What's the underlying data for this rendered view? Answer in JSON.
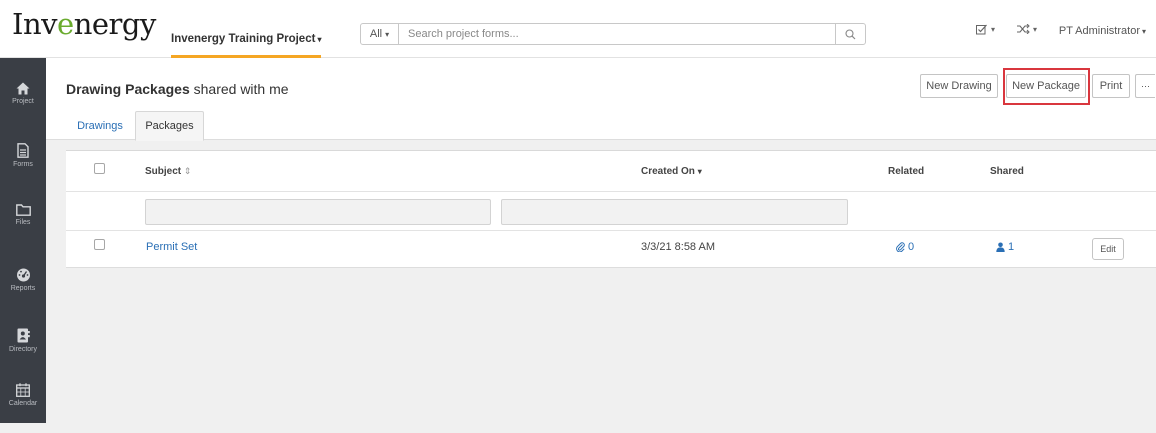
{
  "app": {
    "logo_prefix": "Inv",
    "logo_accent": "e",
    "logo_suffix": "nergy",
    "project_name": "Invenergy Training Project",
    "search": {
      "scope": "All",
      "placeholder": "Search project forms..."
    },
    "user_menu": "PT Administrator",
    "top_icons": [
      "checkbox-icon",
      "shuffle-icon"
    ]
  },
  "sidebar": {
    "items": [
      {
        "label": "Project",
        "icon": "home-icon"
      },
      {
        "label": "Forms",
        "icon": "document-icon"
      },
      {
        "label": "Files",
        "icon": "folder-icon"
      },
      {
        "label": "Reports",
        "icon": "dashboard-icon"
      },
      {
        "label": "Directory",
        "icon": "directory-icon"
      },
      {
        "label": "Calendar",
        "icon": "calendar-icon"
      }
    ]
  },
  "page": {
    "title_bold": "Drawing Packages",
    "title_rest": " shared with me",
    "actions": {
      "new_drawing": "New Drawing",
      "new_package": "New Package",
      "print": "Print",
      "more": "⋯"
    },
    "tabs": [
      {
        "label": "Drawings",
        "active": false
      },
      {
        "label": "Packages",
        "active": true
      }
    ]
  },
  "table": {
    "columns": {
      "subject": "Subject",
      "created_on": "Created On",
      "related": "Related",
      "shared": "Shared"
    },
    "rows": [
      {
        "subject": "Permit Set",
        "created_on": "3/3/21 8:58 AM",
        "related": "0",
        "shared": "1",
        "action": "Edit"
      }
    ]
  },
  "colors": {
    "accent_link": "#2a6fb5",
    "logo_green": "#6aab2e",
    "project_underline": "#f5a623",
    "highlight_box": "#d9363e",
    "sidebar_bg": "#3a3e45"
  }
}
